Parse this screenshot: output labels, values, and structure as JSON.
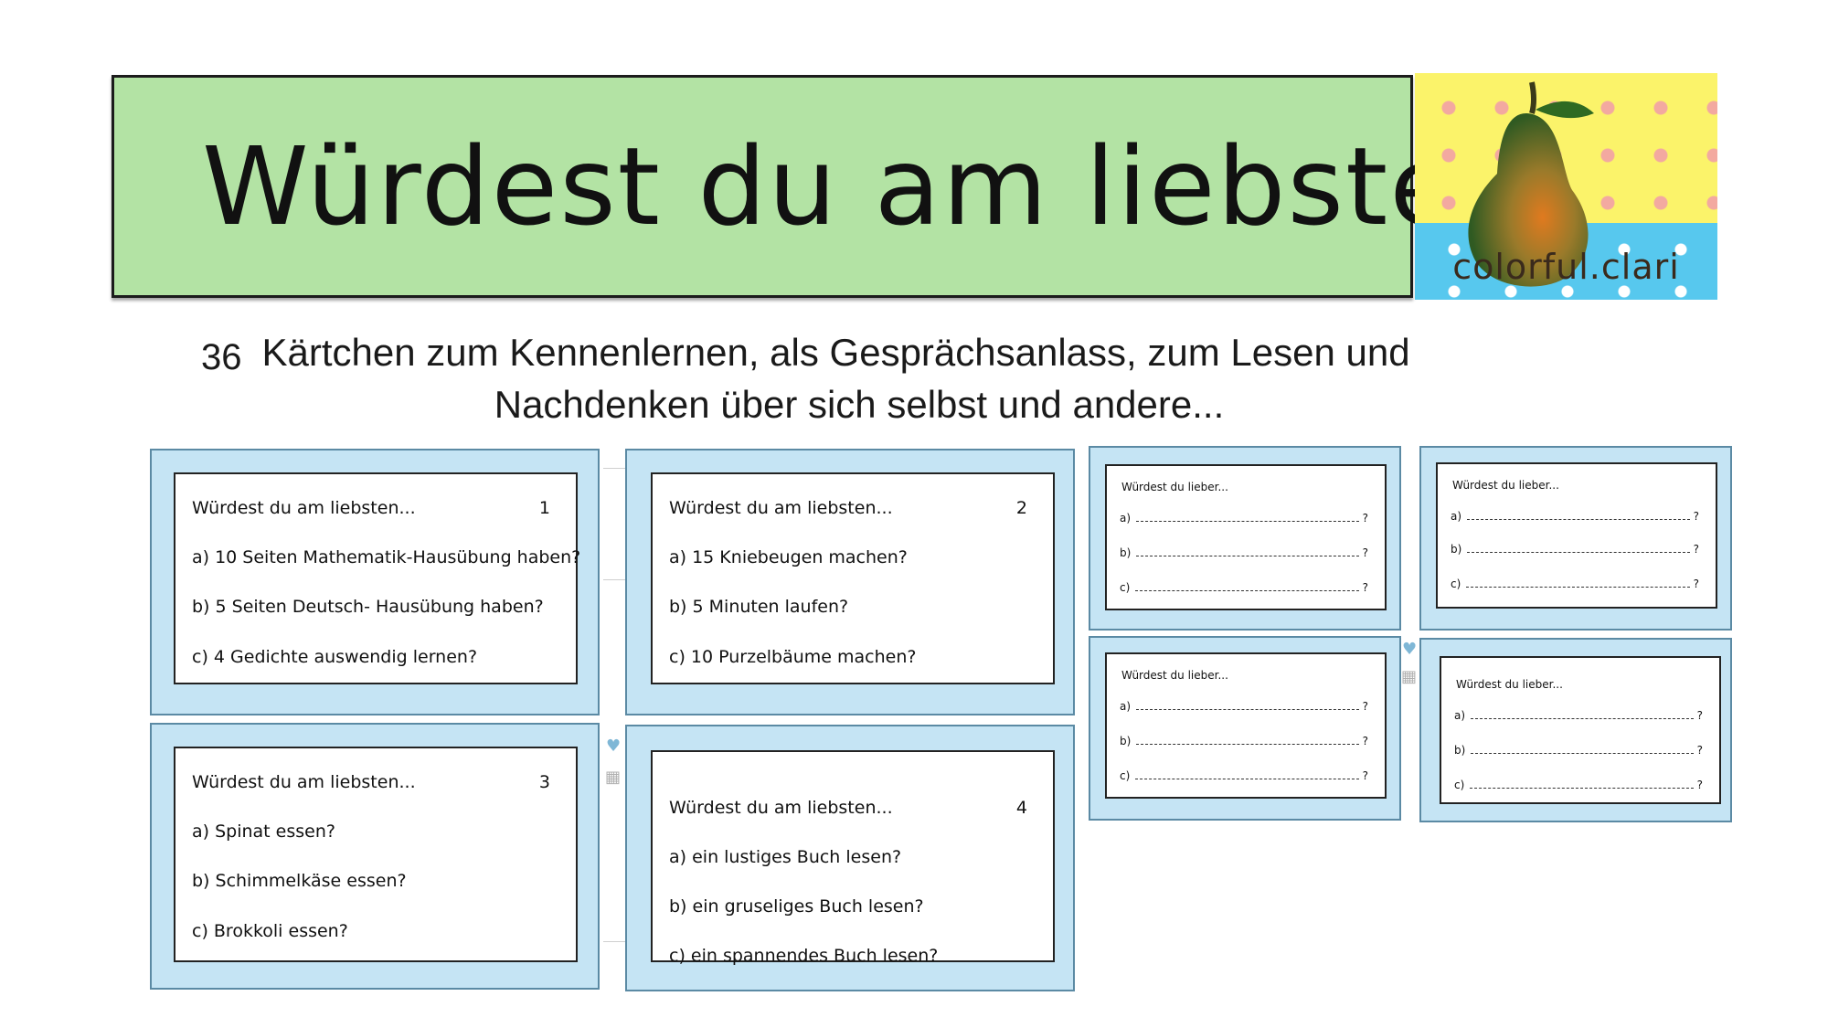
{
  "header": {
    "title": "Würdest du am liebsten...",
    "logo_text": "colorful.clari"
  },
  "subtitle": {
    "number": "36",
    "line1": "Kärtchen zum Kennenlernen, als Gesprächsanlass, zum Lesen und",
    "line2": "Nachdenken über sich selbst und andere..."
  },
  "cards": [
    {
      "title": "Würdest du am liebsten...",
      "number": "1",
      "options": [
        "a) 10 Seiten Mathematik-Hausübung haben?",
        "b)  5 Seiten Deutsch- Hausübung haben?",
        "c) 4 Gedichte auswendig lernen?"
      ]
    },
    {
      "title": "Würdest du am liebsten...",
      "number": "2",
      "options": [
        "a) 15 Kniebeugen machen?",
        "b)  5 Minuten laufen?",
        "c) 10 Purzelbäume machen?"
      ]
    },
    {
      "title": "Würdest du am liebsten...",
      "number": "3",
      "options": [
        "a) Spinat essen?",
        "b) Schimmelkäse essen?",
        "c) Brokkoli essen?"
      ]
    },
    {
      "title": "Würdest du am liebsten...",
      "number": "4",
      "options": [
        "a) ein lustiges Buch lesen?",
        "b) ein gruseliges Buch lesen?",
        "c) ein spannendes Buch lesen?"
      ]
    }
  ],
  "blank_cards": [
    {
      "title": "Würdest du lieber...",
      "labels": [
        "a)",
        "b)",
        "c)"
      ],
      "end": "?"
    },
    {
      "title": "Würdest du lieber...",
      "labels": [
        "a)",
        "b)",
        "c)"
      ],
      "end": "?"
    },
    {
      "title": "Würdest du lieber...",
      "labels": [
        "a)",
        "b)",
        "c)"
      ],
      "end": "?"
    },
    {
      "title": "Würdest du lieber...",
      "labels": [
        "a)",
        "b)",
        "c)"
      ],
      "end": "?"
    }
  ],
  "colors": {
    "banner": "#b3e3a4",
    "card_frame": "#c5e4f4"
  }
}
